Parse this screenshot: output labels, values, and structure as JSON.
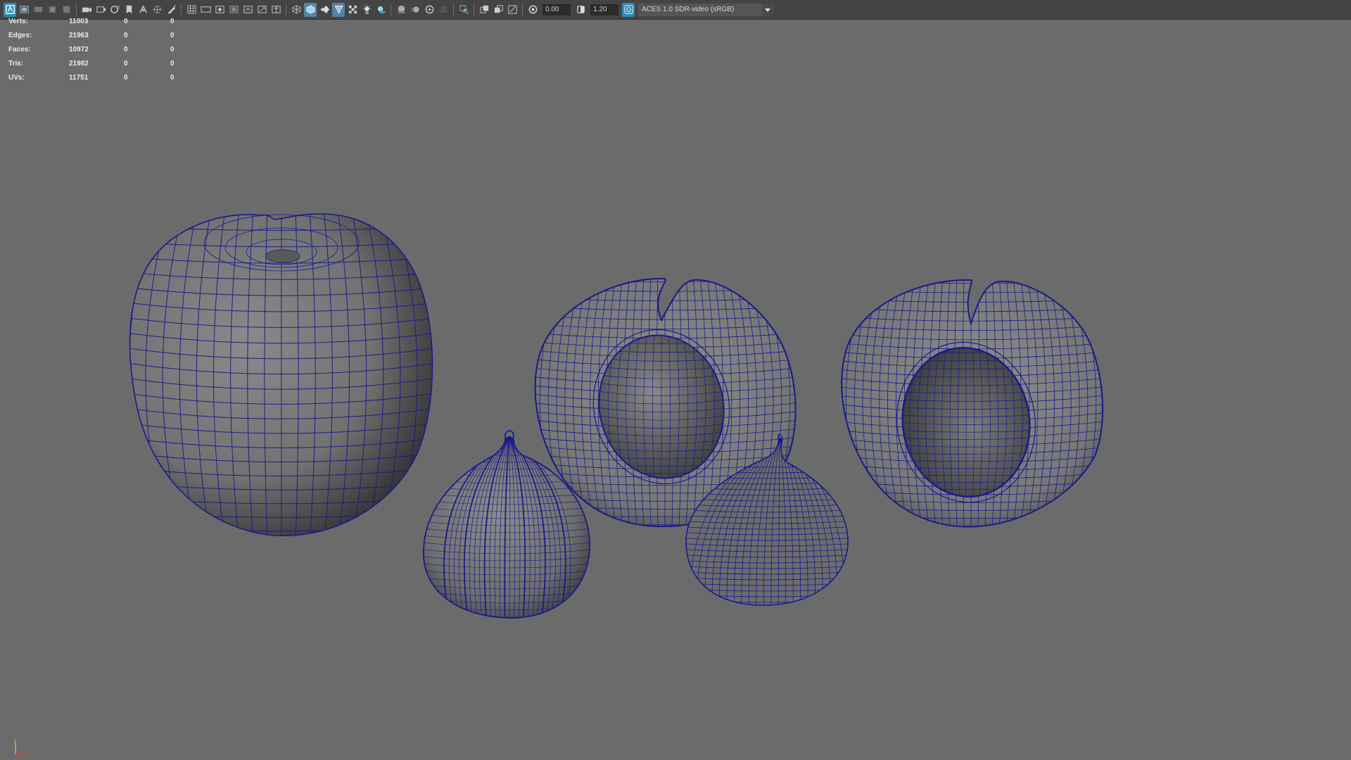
{
  "toolbar": {
    "exposure": "0.00",
    "gamma": "1.20",
    "colorspace": "ACES 1.0 SDR-video (sRGB)"
  },
  "hud": {
    "rows": [
      {
        "label": "Verts:",
        "v1": "11003",
        "v2": "0",
        "v3": "0"
      },
      {
        "label": "Edges:",
        "v1": "21963",
        "v2": "0",
        "v3": "0"
      },
      {
        "label": "Faces:",
        "v1": "10972",
        "v2": "0",
        "v3": "0"
      },
      {
        "label": "Tris:",
        "v1": "21982",
        "v2": "0",
        "v3": "0"
      },
      {
        "label": "UVs:",
        "v1": "11751",
        "v2": "0",
        "v3": "0"
      }
    ]
  },
  "axis": {
    "y": "y",
    "x": "x"
  },
  "colors": {
    "wireframe": "#1a1a8c",
    "viewport_bg": "#6b6b6b",
    "toolbar_bg": "#444444",
    "active_button": "#5285a6"
  },
  "icons": [
    "select-camera-icon",
    "camera-attributes-icon",
    "bookmarks-icon",
    "image-plane-icon",
    "view-transform-icon",
    "camera-icon",
    "film-gate-icon",
    "resolution-gate-icon",
    "gate-mask-icon",
    "field-chart-icon",
    "grid-icon",
    "safe-action-icon",
    "safe-title-icon",
    "pan-zoom-icon",
    "grease-pencil-icon",
    "wireframe-icon",
    "smooth-shade-icon",
    "wireframe-on-shaded-icon",
    "xray-icon",
    "textures-icon",
    "use-all-lights-icon",
    "shadows-icon",
    "screen-space-ao-icon",
    "motion-blur-icon",
    "multisample-aa-icon",
    "depth-of-field-icon",
    "isolate-select-icon",
    "xray-joints-icon",
    "xray-active-icon",
    "exposure-icon",
    "gamma-icon"
  ]
}
